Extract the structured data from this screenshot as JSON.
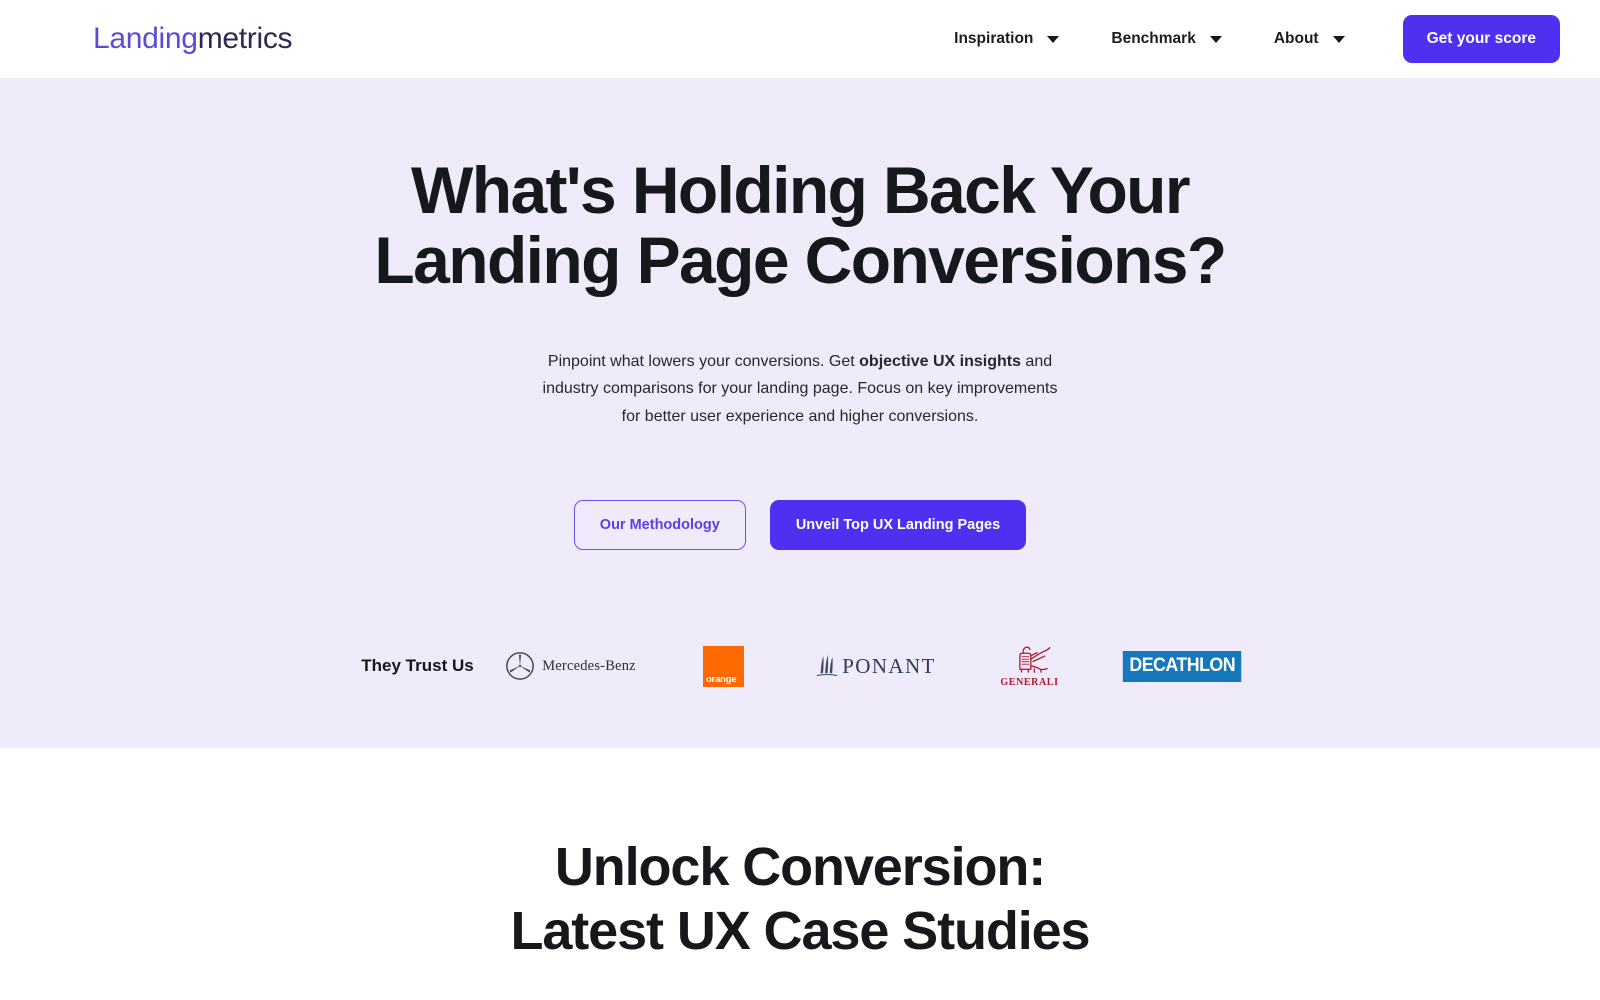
{
  "brand": {
    "logo_first": "Landing",
    "logo_second": "metrics",
    "color_primary": "#4f30f0",
    "color_logo": "#5b4bd6",
    "color_hero_bg": "#efebfb"
  },
  "header": {
    "nav": [
      {
        "label": "Inspiration",
        "icon": "chevron-down-icon"
      },
      {
        "label": "Benchmark",
        "icon": "chevron-down-icon"
      },
      {
        "label": "About",
        "icon": "chevron-down-icon"
      }
    ],
    "cta_label": "Get your score"
  },
  "hero": {
    "title_line1": "What's Holding Back Your Landing",
    "title_line2": "Page Conversions?",
    "sub_part1": "Pinpoint what lowers your conversions. Get ",
    "sub_bold": "objective UX insights",
    "sub_part2": " and industry comparisons for your landing page. Focus on key improvements for better user experience and higher conversions.",
    "btn_secondary": "Our Methodology",
    "btn_primary": "Unveil Top UX Landing Pages"
  },
  "trust": {
    "label": "They Trust Us",
    "logos": [
      {
        "name": "mercedes-benz",
        "text": "Mercedes-Benz",
        "color": "#2e2f36"
      },
      {
        "name": "orange",
        "text": "orange",
        "color": "#ff6a00"
      },
      {
        "name": "ponant",
        "text": "PONANT",
        "color": "#2f3a55"
      },
      {
        "name": "generali",
        "text": "GENERALI",
        "color": "#b01728"
      },
      {
        "name": "decathlon",
        "text": "DECATHLON",
        "color": "#1577bc"
      }
    ]
  },
  "cases_section": {
    "title_line1": "Unlock Conversion:",
    "title_line2": "Latest UX Case Studies"
  }
}
